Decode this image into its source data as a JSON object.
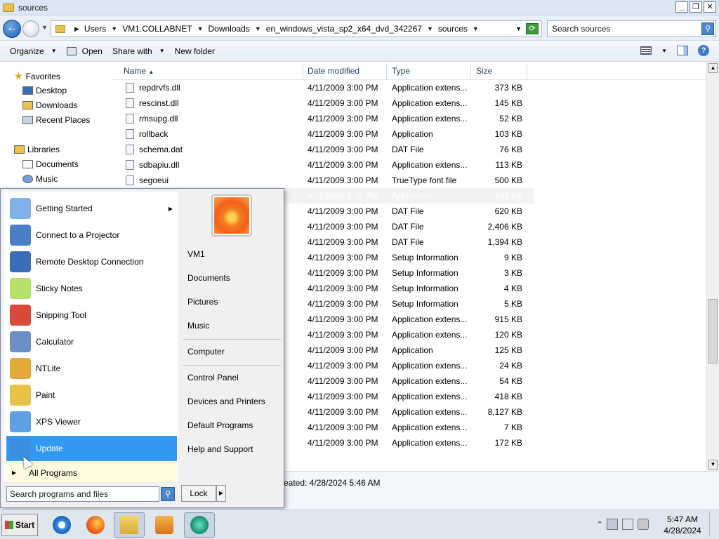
{
  "window": {
    "title": "sources",
    "buttons": [
      "_",
      "❐",
      "✕"
    ]
  },
  "address": {
    "crumbs": [
      "Users",
      "VM1.COLLABNET",
      "Downloads",
      "en_windows_vista_sp2_x64_dvd_342267",
      "sources"
    ],
    "search_placeholder": "Search sources"
  },
  "toolbar": {
    "organize": "Organize",
    "open": "Open",
    "share_with": "Share with",
    "new_folder": "New folder"
  },
  "navpane": {
    "favorites": "Favorites",
    "favorites_items": [
      "Desktop",
      "Downloads",
      "Recent Places"
    ],
    "libraries": "Libraries",
    "libraries_items": [
      "Documents",
      "Music"
    ]
  },
  "columns": {
    "name": "Name",
    "date": "Date modified",
    "type": "Type",
    "size": "Size"
  },
  "files": [
    {
      "name": "repdrvfs.dll",
      "date": "4/11/2009 3:00 PM",
      "type": "Application extens...",
      "size": "373 KB"
    },
    {
      "name": "rescinst.dll",
      "date": "4/11/2009 3:00 PM",
      "type": "Application extens...",
      "size": "145 KB"
    },
    {
      "name": "rmsupg.dll",
      "date": "4/11/2009 3:00 PM",
      "type": "Application extens...",
      "size": "52 KB"
    },
    {
      "name": "rollback",
      "date": "4/11/2009 3:00 PM",
      "type": "Application",
      "size": "103 KB"
    },
    {
      "name": "schema.dat",
      "date": "4/11/2009 3:00 PM",
      "type": "DAT File",
      "size": "76 KB"
    },
    {
      "name": "sdbapiu.dll",
      "date": "4/11/2009 3:00 PM",
      "type": "Application extens...",
      "size": "113 KB"
    },
    {
      "name": "segoeui",
      "date": "4/11/2009 3:00 PM",
      "type": "TrueType font file",
      "size": "500 KB"
    },
    {
      "name": "",
      "date": "4/11/2009 3:00 PM",
      "type": "Application",
      "size": "242 KB"
    },
    {
      "name": "",
      "date": "4/11/2009 3:00 PM",
      "type": "DAT File",
      "size": "620 KB"
    },
    {
      "name": "",
      "date": "4/11/2009 3:00 PM",
      "type": "DAT File",
      "size": "2,406 KB"
    },
    {
      "name": "",
      "date": "4/11/2009 3:00 PM",
      "type": "DAT File",
      "size": "1,394 KB"
    },
    {
      "name": "",
      "date": "4/11/2009 3:00 PM",
      "type": "Setup Information",
      "size": "9 KB"
    },
    {
      "name": "",
      "date": "4/11/2009 3:00 PM",
      "type": "Setup Information",
      "size": "3 KB"
    },
    {
      "name": "",
      "date": "4/11/2009 3:00 PM",
      "type": "Setup Information",
      "size": "4 KB"
    },
    {
      "name": "",
      "date": "4/11/2009 3:00 PM",
      "type": "Setup Information",
      "size": "5 KB"
    },
    {
      "name": "",
      "date": "4/11/2009 3:00 PM",
      "type": "Application extens...",
      "size": "915 KB"
    },
    {
      "name": "",
      "date": "4/11/2009 3:00 PM",
      "type": "Application extens...",
      "size": "120 KB"
    },
    {
      "name": "",
      "date": "4/11/2009 3:00 PM",
      "type": "Application",
      "size": "125 KB"
    },
    {
      "name": "",
      "date": "4/11/2009 3:00 PM",
      "type": "Application extens...",
      "size": "24 KB"
    },
    {
      "name": "",
      "date": "4/11/2009 3:00 PM",
      "type": "Application extens...",
      "size": "54 KB"
    },
    {
      "name": "",
      "date": "4/11/2009 3:00 PM",
      "type": "Application extens...",
      "size": "418 KB"
    },
    {
      "name": "",
      "date": "4/11/2009 3:00 PM",
      "type": "Application extens...",
      "size": "8,127 KB"
    },
    {
      "name": "",
      "date": "4/11/2009 3:00 PM",
      "type": "Application extens...",
      "size": "7 KB"
    },
    {
      "name": "",
      "date": "4/11/2009 3:00 PM",
      "type": "Application extens...",
      "size": "172 KB"
    }
  ],
  "details": {
    "text": "eated: 4/28/2024 5:46 AM"
  },
  "startmenu": {
    "programs": [
      {
        "label": "Getting Started",
        "icon": "getting-started-icon",
        "has_arrow": true
      },
      {
        "label": "Connect to a Projector",
        "icon": "projector-icon"
      },
      {
        "label": "Remote Desktop Connection",
        "icon": "remote-desktop-icon"
      },
      {
        "label": "Sticky Notes",
        "icon": "sticky-notes-icon"
      },
      {
        "label": "Snipping Tool",
        "icon": "snipping-tool-icon"
      },
      {
        "label": "Calculator",
        "icon": "calculator-icon"
      },
      {
        "label": "NTLite",
        "icon": "ntlite-icon"
      },
      {
        "label": "Paint",
        "icon": "paint-icon"
      },
      {
        "label": "XPS Viewer",
        "icon": "xps-viewer-icon"
      },
      {
        "label": "Update",
        "icon": "update-icon",
        "active": true
      }
    ],
    "all_programs": "All Programs",
    "search_placeholder": "Search programs and files",
    "right_links": [
      "VM1",
      "Documents",
      "Pictures",
      "Music",
      "Computer",
      "Control Panel",
      "Devices and Printers",
      "Default Programs",
      "Help and Support"
    ],
    "lock": "Lock"
  },
  "taskbar": {
    "start": "Start",
    "time": "5:47 AM",
    "date": "4/28/2024"
  },
  "colors": {
    "accent": "#3399f0",
    "title_bar": "#dbe6f4",
    "taskbar": "#dfe6ee"
  }
}
